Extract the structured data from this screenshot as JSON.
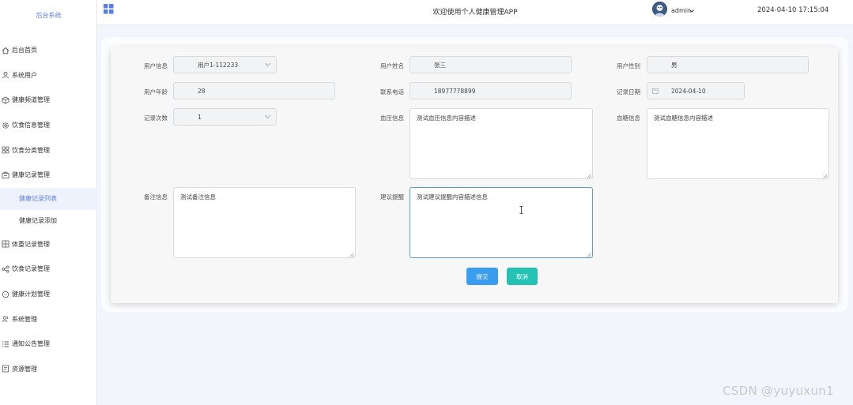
{
  "sidebar": {
    "brand": "后台系统",
    "items": [
      {
        "label": "后台首页",
        "icon": "home-icon"
      },
      {
        "label": "系统用户",
        "icon": "user-icon"
      },
      {
        "label": "健康频道管理",
        "icon": "cube-icon"
      },
      {
        "label": "饮食信息管理",
        "icon": "gear-icon"
      },
      {
        "label": "饮食分类管理",
        "icon": "grid-icon"
      },
      {
        "label": "健康记录管理",
        "icon": "record-icon"
      }
    ],
    "sub_items": [
      {
        "label": "健康记录列表",
        "active": true
      },
      {
        "label": "健康记录添加",
        "active": false
      }
    ],
    "items_after": [
      {
        "label": "体重记录管理",
        "icon": "columns-icon"
      },
      {
        "label": "饮食记录管理",
        "icon": "share-icon"
      },
      {
        "label": "健康计划管理",
        "icon": "chat-icon"
      },
      {
        "label": "系统管理",
        "icon": "users-icon"
      },
      {
        "label": "通知公告管理",
        "icon": "list-icon"
      },
      {
        "label": "资源管理",
        "icon": "doc-icon"
      }
    ]
  },
  "header": {
    "title": "欢迎使用个人健康管理APP",
    "user": "admin",
    "datetime": "2024-04-10 17:15:04"
  },
  "form": {
    "user_info": {
      "label": "用户信息",
      "value": "用户1-112233"
    },
    "user_name": {
      "label": "用户姓名",
      "value": "张三"
    },
    "user_gender": {
      "label": "用户性别",
      "value": "男"
    },
    "user_age": {
      "label": "用户年龄",
      "value": "28"
    },
    "phone": {
      "label": "联系电话",
      "value": "18977778899"
    },
    "record_date": {
      "label": "记录日期",
      "value": "2024-04-10"
    },
    "record_count": {
      "label": "记录次数",
      "value": "1"
    },
    "blood_pressure": {
      "label": "血压信息",
      "value": "测试血压信息内容描述"
    },
    "blood_sugar": {
      "label": "血糖信息",
      "value": "测试血糖信息内容描述"
    },
    "remark": {
      "label": "备注信息",
      "value": "测试备注信息"
    },
    "suggestion": {
      "label": "建议提醒",
      "value": "测试建议提醒内容描述信息"
    },
    "submit_label": "提交",
    "cancel_label": "取消"
  },
  "watermark": "CSDN @yuyuxun1",
  "colors": {
    "accent": "#5b7de8",
    "submit": "#3b9df0",
    "cancel": "#23c2b5"
  }
}
